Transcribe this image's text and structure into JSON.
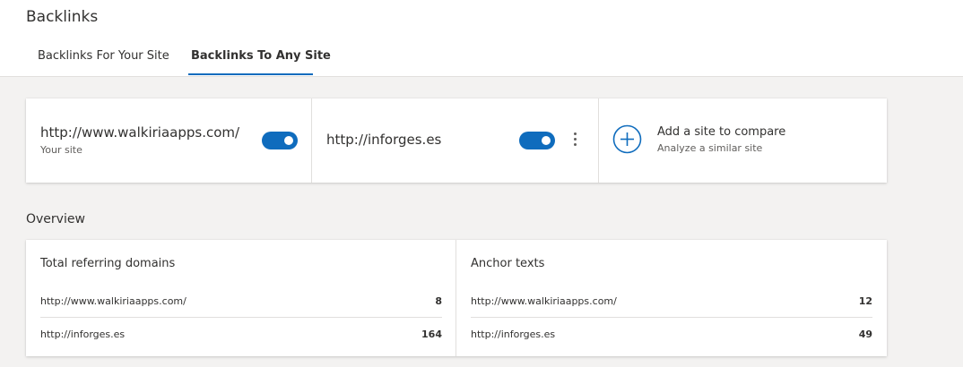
{
  "page": {
    "title": "Backlinks"
  },
  "tabs": [
    {
      "label": "Backlinks For Your Site",
      "active": false
    },
    {
      "label": "Backlinks To Any Site",
      "active": true
    }
  ],
  "sites": [
    {
      "url": "http://www.walkiriaapps.com/",
      "subtitle": "Your site",
      "enabled": true
    },
    {
      "url": "http://inforges.es",
      "enabled": true
    }
  ],
  "add_site": {
    "title": "Add a site to compare",
    "subtitle": "Analyze a similar site",
    "icon": "plus-circle-icon"
  },
  "overview": {
    "title": "Overview",
    "panels": [
      {
        "title": "Total referring domains",
        "rows": [
          {
            "site": "http://www.walkiriaapps.com/",
            "value": "8"
          },
          {
            "site": "http://inforges.es",
            "value": "164"
          }
        ]
      },
      {
        "title": "Anchor texts",
        "rows": [
          {
            "site": "http://www.walkiriaapps.com/",
            "value": "12"
          },
          {
            "site": "http://inforges.es",
            "value": "49"
          }
        ]
      }
    ]
  },
  "colors": {
    "accent": "#0f6cbd",
    "background": "#f3f2f1",
    "card": "#ffffff",
    "divider": "#e1dfdd"
  }
}
